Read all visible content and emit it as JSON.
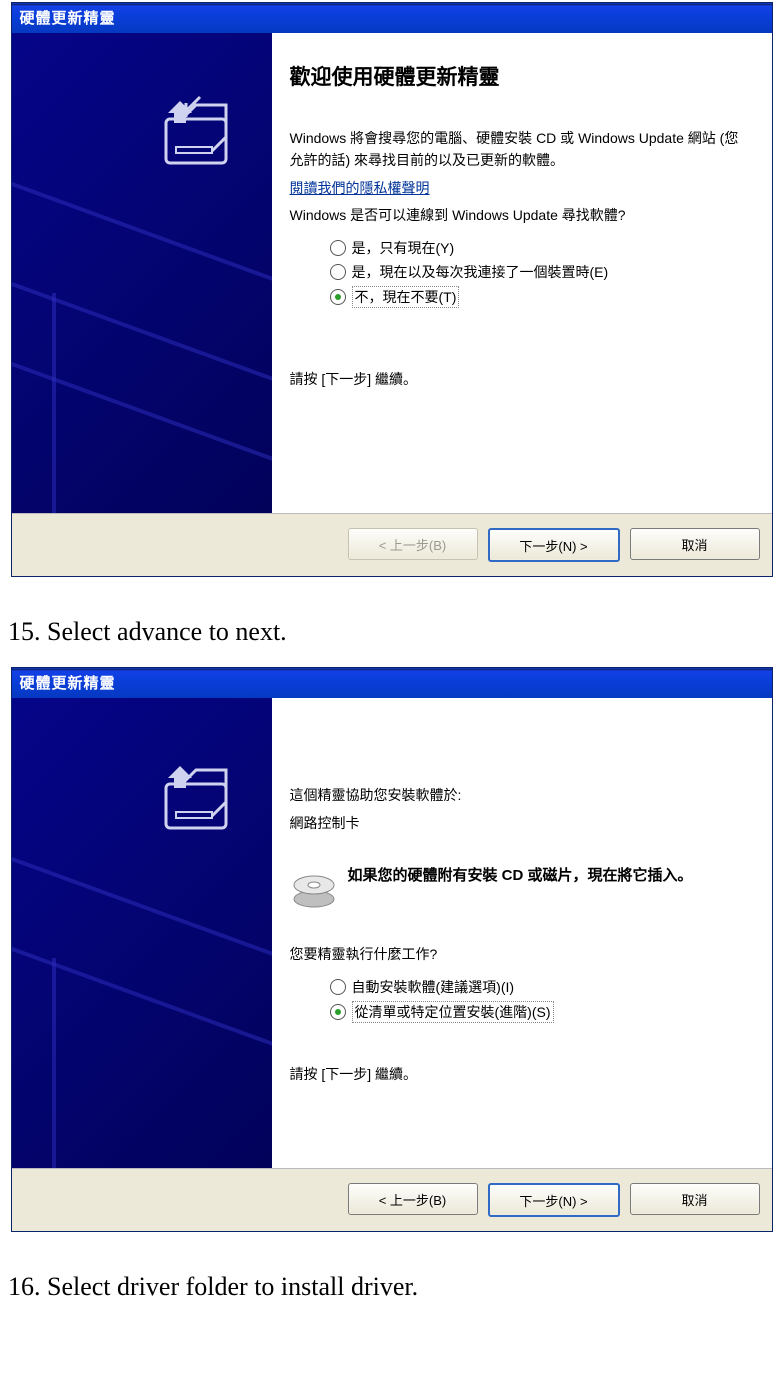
{
  "dialog1": {
    "title": "硬體更新精靈",
    "heading": "歡迎使用硬體更新精靈",
    "desc": "Windows 將會搜尋您的電腦、硬體安裝 CD 或 Windows Update 網站 (您允許的話) 來尋找目前的以及已更新的軟體。",
    "privacy_link": "閱讀我們的隱私權聲明",
    "question": "Windows 是否可以連線到 Windows Update 尋找軟體?",
    "options": [
      "是，只有現在(Y)",
      "是，現在以及每次我連接了一個裝置時(E)",
      "不，現在不要(T)"
    ],
    "continue_hint": "請按 [下一步] 繼續。",
    "buttons": {
      "back": "< 上一步(B)",
      "next": "下一步(N) >",
      "cancel": "取消"
    }
  },
  "step15": "15. Select advance to next.",
  "dialog2": {
    "title": "硬體更新精靈",
    "intro": "這個精靈協助您安裝軟體於:",
    "device": "網路控制卡",
    "cd_hint": "如果您的硬體附有安裝 CD 或磁片，現在將它插入。",
    "question": "您要精靈執行什麼工作?",
    "options": [
      "自動安裝軟體(建議選項)(I)",
      "從清單或特定位置安裝(進階)(S)"
    ],
    "continue_hint": "請按 [下一步] 繼續。",
    "buttons": {
      "back": "< 上一步(B)",
      "next": "下一步(N) >",
      "cancel": "取消"
    }
  },
  "step16": "16. Select driver folder to install driver."
}
